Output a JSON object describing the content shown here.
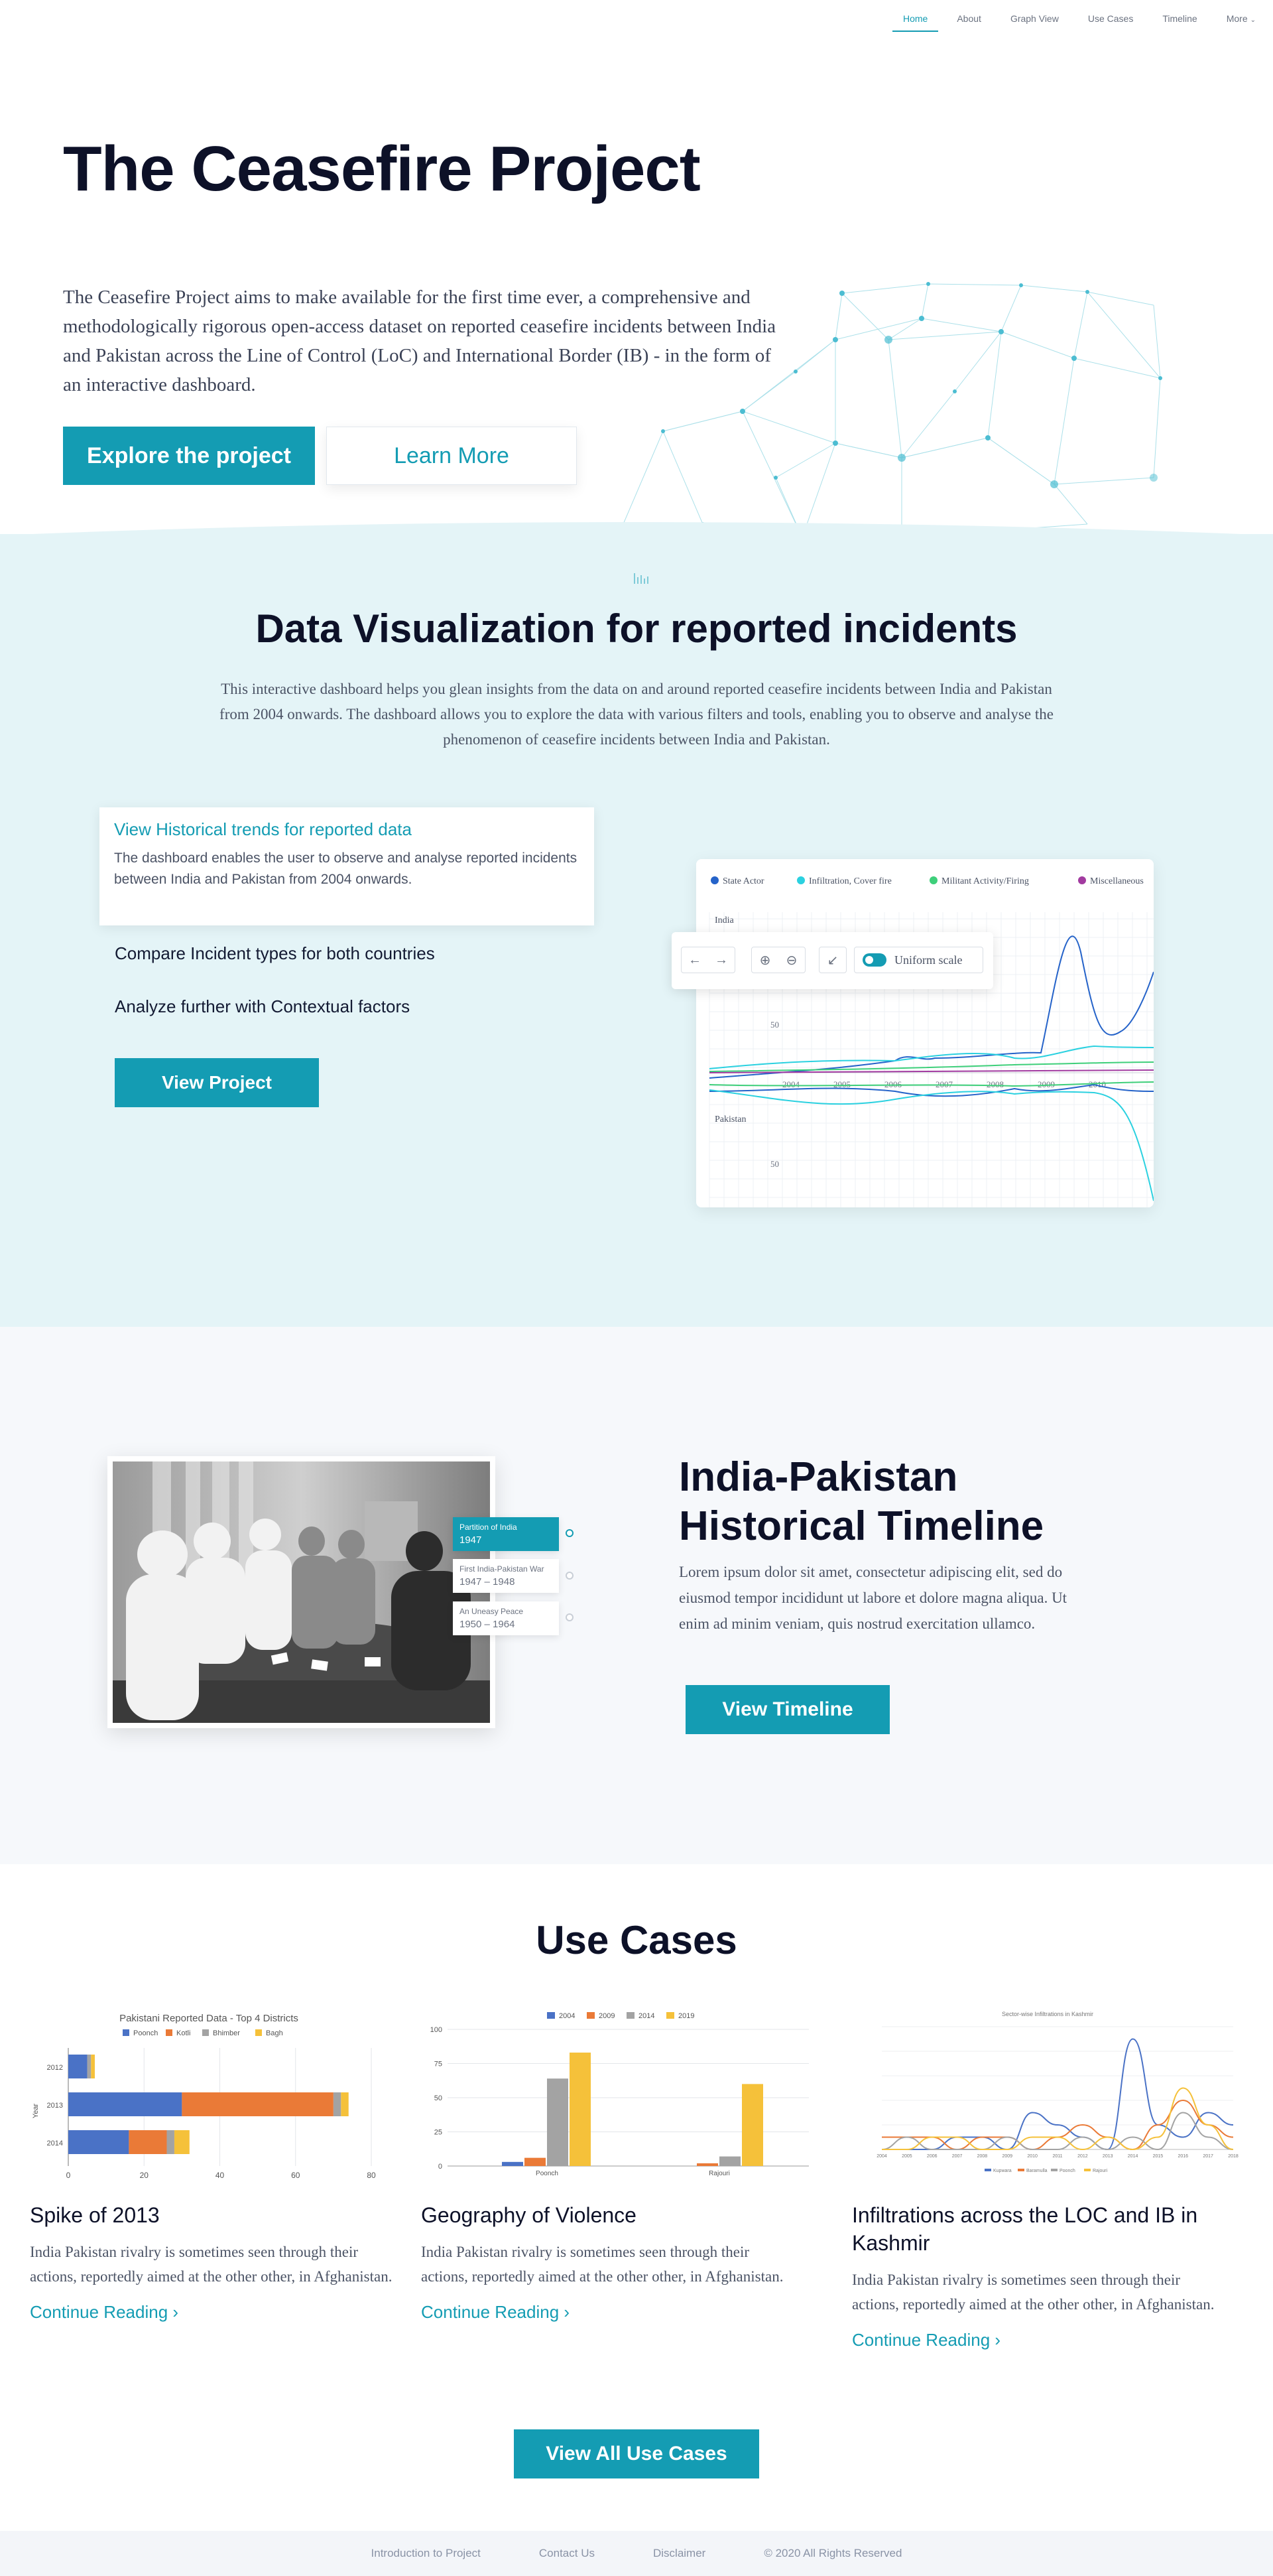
{
  "nav": {
    "items": [
      "Home",
      "About",
      "Graph View",
      "Use Cases",
      "Timeline",
      "More"
    ]
  },
  "hero": {
    "title": "The Ceasefire Project",
    "description": "The Ceasefire Project aims to make available for the first time ever, a comprehensive and methodologically rigorous open-access dataset on reported ceasefire incidents between India and Pakistan across the Line of Control (LoC) and International Border (IB) - in the form of an interactive dashboard.",
    "primary_button": "Explore the project",
    "secondary_button": "Learn More"
  },
  "data_viz": {
    "title": "Data Visualization for reported incidents",
    "description": "This interactive dashboard helps you glean insights from the data on and around reported ceasefire incidents between India and Pakistan from 2004 onwards. The dashboard allows you to explore the data with various filters and tools, enabling you to observe and analyse the phenomenon of ceasefire incidents between India and Pakistan.",
    "features": [
      {
        "title": "View Historical trends for reported data",
        "description": "The dashboard enables the user to observe and analyse reported incidents between India and Pakistan from 2004 onwards."
      },
      {
        "title": "Compare Incident types for both countries"
      },
      {
        "title": "Analyze further with Contextual factors"
      }
    ],
    "button": "View Project",
    "toolbar": {
      "toggle_label": "Uniform scale"
    }
  },
  "timeline": {
    "title_line1": "India-Pakistan",
    "title_line2": "Historical Timeline",
    "description": "Lorem ipsum dolor sit amet, consectetur adipiscing elit, sed do eiusmod tempor incididunt ut labore et dolore magna aliqua. Ut enim ad minim veniam, quis nostrud exercitation ullamco.",
    "button": "View Timeline",
    "events": [
      {
        "title": "Partition of India",
        "years": "1947"
      },
      {
        "title": "First India-Pakistan War",
        "years": "1947 – 1948"
      },
      {
        "title": "An Uneasy Peace",
        "years": "1950 – 1964"
      }
    ]
  },
  "use_cases": {
    "title": "Use Cases",
    "cards": [
      {
        "title": "Spike of 2013",
        "description": "India Pakistan rivalry is sometimes seen through their actions, reportedly aimed at the other other, in Afghanistan.",
        "link": "Continue Reading ›"
      },
      {
        "title": "Geography of Violence",
        "description": "India Pakistan rivalry is sometimes seen through their actions, reportedly aimed at the other other, in Afghanistan.",
        "link": "Continue Reading ›"
      },
      {
        "title": "Infiltrations across the LOC and IB in Kashmir",
        "description": "India Pakistan rivalry is sometimes seen through their actions, reportedly aimed at the other other, in Afghanistan.",
        "link": "Continue Reading ›"
      }
    ],
    "button": "View All Use Cases"
  },
  "footer": {
    "links": [
      "Introduction to Project",
      "Contact Us",
      "Disclaimer",
      "© 2020 All Rights Reserved"
    ]
  },
  "colors": {
    "accent": "#149cb3",
    "heading": "#0d1128",
    "viz_bg": "#e4f4f7",
    "timeline_bg": "#f6f8fb"
  },
  "chart_data": [
    {
      "type": "line",
      "title": "",
      "legend": [
        "State Actor",
        "Infiltration, Cover fire",
        "Militant Activity/Firing",
        "Miscellaneous"
      ],
      "series_colors": [
        "#2563c9",
        "#2bd1e0",
        "#3ecf7a",
        "#a23ba0"
      ],
      "panels": [
        "India",
        "Pakistan"
      ],
      "x": [
        "2004",
        "2005",
        "2006",
        "2007",
        "2008",
        "2009",
        "2010"
      ],
      "y_tick": 50,
      "legend_position": "top"
    },
    {
      "type": "bar",
      "orientation": "horizontal",
      "title": "Pakistani Reported Data - Top 4 Districts",
      "legend": [
        "Poonch",
        "Kotli",
        "Bhimber",
        "Bagh"
      ],
      "series_colors": [
        "#4a72c6",
        "#ea7a37",
        "#a3a3a3",
        "#f5c13a"
      ],
      "categories": [
        "2012",
        "2013",
        "2014"
      ],
      "ylabel": "Year",
      "series": [
        {
          "name": "Poonch",
          "values": [
            5,
            30,
            16
          ]
        },
        {
          "name": "Kotli",
          "values": [
            0,
            40,
            10
          ]
        },
        {
          "name": "Bhimber",
          "values": [
            1,
            2,
            2
          ]
        },
        {
          "name": "Bagh",
          "values": [
            1,
            2,
            4
          ]
        }
      ],
      "xlim": [
        0,
        80
      ],
      "x_ticks": [
        "0",
        "20",
        "40",
        "60",
        "80"
      ]
    },
    {
      "type": "bar",
      "title": "",
      "legend": [
        "2004",
        "2009",
        "2014",
        "2019"
      ],
      "series_colors": [
        "#4a72c6",
        "#ea7a37",
        "#a3a3a3",
        "#f5c13a"
      ],
      "categories": [
        "Poonch",
        "Rajouri"
      ],
      "series": [
        {
          "name": "2004",
          "values": [
            3,
            0
          ]
        },
        {
          "name": "2009",
          "values": [
            6,
            2
          ]
        },
        {
          "name": "2014",
          "values": [
            64,
            7
          ]
        },
        {
          "name": "2019",
          "values": [
            83,
            60
          ]
        }
      ],
      "ylim": [
        0,
        100
      ],
      "y_ticks": [
        "0",
        "25",
        "50",
        "75",
        "100"
      ]
    },
    {
      "type": "line",
      "title": "Sector-wise Infiltrations in Kashmir",
      "x": [
        "2004",
        "2005",
        "2006",
        "2007",
        "2008",
        "2009",
        "2010",
        "2011",
        "2012",
        "2013",
        "2014",
        "2015",
        "2016",
        "2017",
        "2018"
      ],
      "series_colors": [
        "#4a72c6",
        "#ea7a37",
        "#a3a3a3",
        "#f5c13a"
      ],
      "legend": [
        "Kupwara",
        "Baramulla",
        "Poonch",
        "Rajouri"
      ],
      "series": [
        {
          "name": "Kupwara",
          "values": [
            0,
            0,
            0,
            1,
            1,
            0,
            3,
            2,
            1,
            0,
            9,
            2,
            1,
            3,
            2
          ]
        },
        {
          "name": "Baramulla",
          "values": [
            1,
            1,
            1,
            0,
            1,
            1,
            0,
            1,
            2,
            1,
            0,
            2,
            4,
            2,
            1
          ]
        },
        {
          "name": "Poonch",
          "values": [
            0,
            1,
            0,
            0,
            0,
            1,
            0,
            0,
            1,
            0,
            1,
            0,
            3,
            1,
            0
          ]
        },
        {
          "name": "Rajouri",
          "values": [
            0,
            0,
            1,
            1,
            0,
            0,
            1,
            1,
            0,
            1,
            0,
            1,
            5,
            2,
            0
          ]
        }
      ],
      "ylim": [
        0,
        10
      ]
    }
  ]
}
